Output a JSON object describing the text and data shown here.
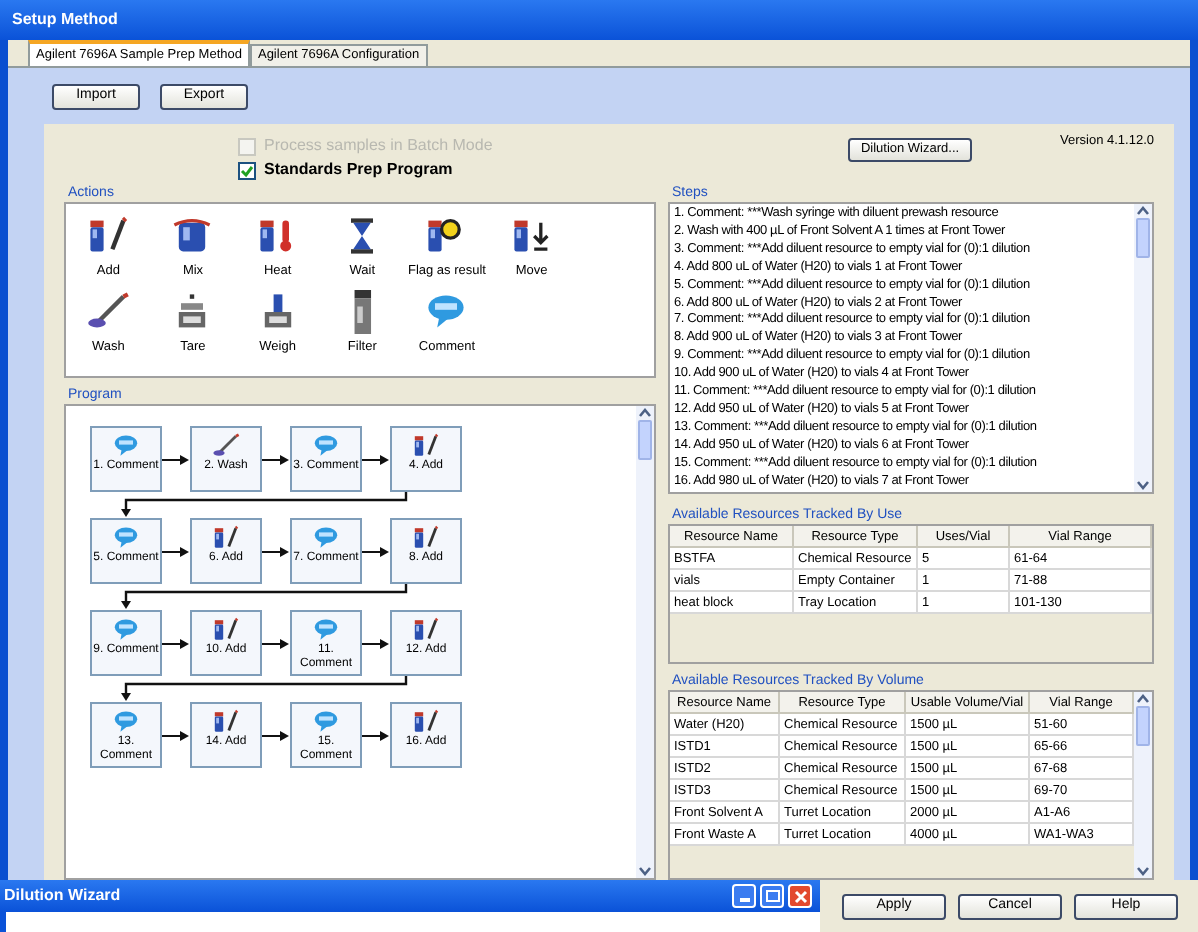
{
  "window": {
    "title": "Setup Method"
  },
  "tabs": [
    {
      "label": "Agilent 7696A Sample Prep Method",
      "selected": true
    },
    {
      "label": "Agilent 7696A Configuration",
      "selected": false
    }
  ],
  "toolbar_buttons": [
    "Import",
    "Export"
  ],
  "batch_mode": {
    "label": "Process samples in Batch Mode",
    "checked": false,
    "disabled": true
  },
  "standards_prep": {
    "label": "Standards Prep Program",
    "checked": true,
    "disabled": false
  },
  "version": "Version 4.1.12.0",
  "dilution_wizard_button": "Dilution Wizard...",
  "actions": {
    "title": "Actions",
    "items": [
      {
        "label": "Add",
        "kind": "add"
      },
      {
        "label": "Mix",
        "kind": "mix"
      },
      {
        "label": "Heat",
        "kind": "heat"
      },
      {
        "label": "Wait",
        "kind": "wait"
      },
      {
        "label": "Flag as result",
        "kind": "flag"
      },
      {
        "label": "Move",
        "kind": "move"
      },
      {
        "label": "Wash",
        "kind": "wash"
      },
      {
        "label": "Tare",
        "kind": "tare"
      },
      {
        "label": "Weigh",
        "kind": "weigh"
      },
      {
        "label": "Filter",
        "kind": "filter"
      },
      {
        "label": "Comment",
        "kind": "comment"
      }
    ]
  },
  "program": {
    "title": "Program",
    "steps": [
      {
        "label": "1. Comment",
        "kind": "comment"
      },
      {
        "label": "2. Wash",
        "kind": "wash"
      },
      {
        "label": "3. Comment",
        "kind": "comment"
      },
      {
        "label": "4. Add",
        "kind": "add"
      },
      {
        "label": "5. Comment",
        "kind": "comment"
      },
      {
        "label": "6. Add",
        "kind": "add"
      },
      {
        "label": "7. Comment",
        "kind": "comment"
      },
      {
        "label": "8. Add",
        "kind": "add"
      },
      {
        "label": "9. Comment",
        "kind": "comment"
      },
      {
        "label": "10. Add",
        "kind": "add"
      },
      {
        "label": "11. Comment",
        "kind": "comment"
      },
      {
        "label": "12. Add",
        "kind": "add"
      },
      {
        "label": "13. Comment",
        "kind": "comment"
      },
      {
        "label": "14. Add",
        "kind": "add"
      },
      {
        "label": "15. Comment",
        "kind": "comment"
      },
      {
        "label": "16. Add",
        "kind": "add"
      }
    ]
  },
  "steps": {
    "title": "Steps",
    "items": [
      "1. Comment: ***Wash syringe with diluent prewash resource",
      "2. Wash with 400 µL of Front Solvent A 1 times at Front Tower",
      "3. Comment: ***Add diluent resource to empty vial for (0):1 dilution",
      "4. Add 800 uL of Water (H20) to vials 1 at Front Tower",
      "5. Comment: ***Add diluent resource to empty vial for (0):1 dilution",
      "6. Add 800 uL of Water (H20) to vials 2 at Front Tower",
      "7. Comment: ***Add diluent resource to empty vial for (0):1 dilution",
      "8. Add 900 uL of Water (H20) to vials 3 at Front Tower",
      "9. Comment: ***Add diluent resource to empty vial for (0):1 dilution",
      "10. Add 900 uL of Water (H20) to vials 4 at Front Tower",
      "11. Comment: ***Add diluent resource to empty vial for (0):1 dilution",
      "12. Add 950 uL of Water (H20) to vials 5 at Front Tower",
      "13. Comment: ***Add diluent resource to empty vial for (0):1 dilution",
      "14. Add 950 uL of Water (H20) to vials 6 at Front Tower",
      "15. Comment: ***Add diluent resource to empty vial for (0):1 dilution",
      "16. Add 980 uL of Water (H20) to vials 7 at Front Tower"
    ]
  },
  "resources_by_use": {
    "title": "Available Resources Tracked By Use",
    "columns": [
      "Resource Name",
      "Resource Type",
      "Uses/Vial",
      "Vial Range"
    ],
    "rows": [
      [
        "BSTFA",
        "Chemical Resource",
        "5",
        "61-64"
      ],
      [
        "vials",
        "Empty Container",
        "1",
        "71-88"
      ],
      [
        "heat block",
        "Tray Location",
        "1",
        "101-130"
      ]
    ]
  },
  "resources_by_volume": {
    "title": "Available Resources Tracked By Volume",
    "columns": [
      "Resource Name",
      "Resource Type",
      "Usable Volume/Vial",
      "Vial Range"
    ],
    "rows": [
      [
        "Water (H20)",
        "Chemical Resource",
        "1500 µL",
        "51-60"
      ],
      [
        "ISTD1",
        "Chemical Resource",
        "1500 µL",
        "65-66"
      ],
      [
        "ISTD2",
        "Chemical Resource",
        "1500 µL",
        "67-68"
      ],
      [
        "ISTD3",
        "Chemical Resource",
        "1500 µL",
        "69-70"
      ],
      [
        "Front Solvent A",
        "Turret Location",
        "2000 µL",
        "A1-A6"
      ],
      [
        "Front Waste A",
        "Turret Location",
        "4000 µL",
        "WA1-WA3"
      ]
    ]
  },
  "dialog_buttons": [
    "Apply",
    "Cancel",
    "Help"
  ],
  "dilution_wizard_window": {
    "title": "Dilution Wizard"
  }
}
